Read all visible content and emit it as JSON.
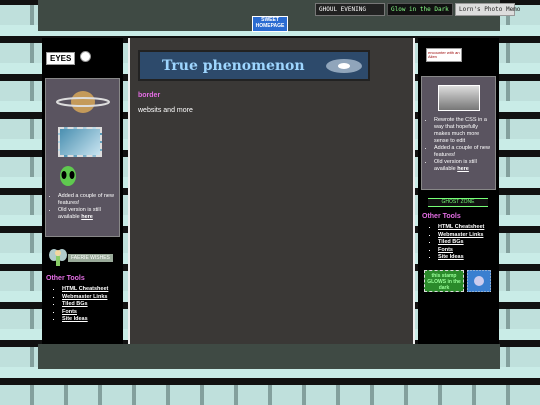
{
  "top_badges": [
    "GHOUL EVENING",
    "Glow in the Dark",
    "Lorn's Photo Memo"
  ],
  "sweet_badge": "SWEET HOMEPAGE",
  "left": {
    "eyes_label": "EYES",
    "list": [
      {
        "text": "Added a couple of new features!"
      },
      {
        "text": "Old version is still available ",
        "link": "here"
      }
    ],
    "badge_text": "FAERIE WISHES",
    "other_title": "Other Tools",
    "links": [
      "HTML Cheatsheet",
      "Webmaster Links",
      "Tiled BGs",
      "Fonts",
      "Site Ideas"
    ]
  },
  "main": {
    "banner_title": "True phenomenon",
    "heading": "border",
    "text": "websits and more"
  },
  "right": {
    "alien_label": "encounter with an Alien",
    "list": [
      {
        "text": "Rewrote the CSS in a way that hopefully makes much more sense to edit"
      },
      {
        "text": "Added a couple of new features!"
      },
      {
        "text": "Old version is still available ",
        "link": "here"
      }
    ],
    "ghost_zone": "GHOST ZONE",
    "other_title": "Other Tools",
    "links": [
      "HTML Cheatsheet",
      "Webmaster Links",
      "Tiled BGs",
      "Fonts",
      "Site Ideas"
    ],
    "stamp_text": "this stamp GLOWS in the dark"
  }
}
